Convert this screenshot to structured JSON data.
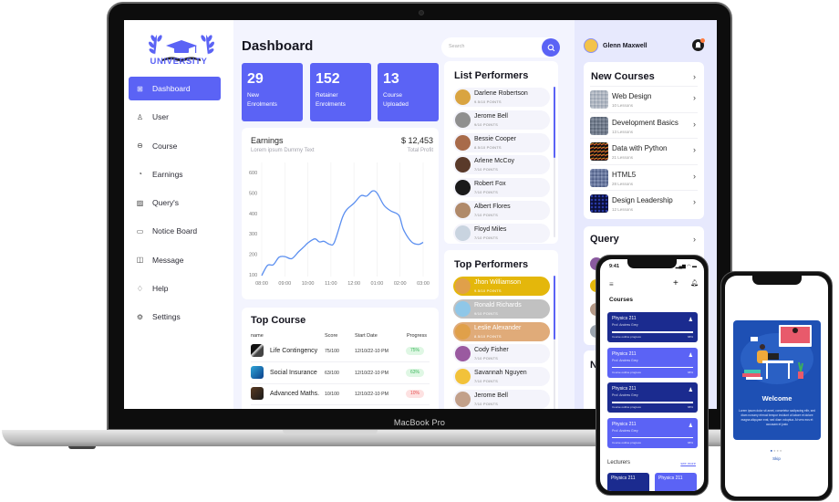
{
  "device_label": "MacBook Pro",
  "sidebar": {
    "logo_text": "UNIVERSITY",
    "items": [
      {
        "label": "Dashboard",
        "icon": "grid-icon",
        "active": true
      },
      {
        "label": "User",
        "icon": "user-icon"
      },
      {
        "label": "Course",
        "icon": "course-icon"
      },
      {
        "label": "Earnings",
        "icon": "wallet-icon"
      },
      {
        "label": "Query's",
        "icon": "edit-note-icon"
      },
      {
        "label": "Notice Board",
        "icon": "notice-icon"
      },
      {
        "label": "Message",
        "icon": "message-icon"
      },
      {
        "label": "Help",
        "icon": "help-icon"
      },
      {
        "label": "Settings",
        "icon": "settings-icon"
      }
    ]
  },
  "header": {
    "title": "Dashboard",
    "search_placeholder": "Search"
  },
  "stats": [
    {
      "value": "29",
      "label_line1": "New",
      "label_line2": "Enrolments"
    },
    {
      "value": "152",
      "label_line1": "Retainer",
      "label_line2": "Enrolments"
    },
    {
      "value": "13",
      "label_line1": "Course",
      "label_line2": "Uploaded"
    }
  ],
  "earnings": {
    "title": "Earnings",
    "subtitle": "Lorem ipsum Dummy Text",
    "amount": "$ 12,453",
    "amount_label": "Total Profit"
  },
  "chart_data": {
    "type": "line",
    "title": "Earnings",
    "xlabel": "",
    "ylabel": "",
    "categories": [
      "08:00",
      "09:00",
      "10:00",
      "11:00",
      "12:00",
      "01:00",
      "02:00",
      "03:00"
    ],
    "yticks": [
      100,
      200,
      300,
      400,
      500,
      600
    ],
    "ylim": [
      90,
      650
    ],
    "grid": true,
    "series": [
      {
        "name": "Earnings",
        "x": [
          0,
          0.25,
          0.5,
          0.75,
          1.0,
          1.3,
          1.6,
          1.85,
          2.0,
          2.3,
          2.5,
          2.7,
          2.95,
          3.15,
          3.5,
          3.7,
          4.0,
          4.3,
          4.55,
          4.8,
          5.0,
          5.3,
          5.6,
          5.95,
          6.15,
          6.5,
          6.8,
          7.0
        ],
        "values": [
          95,
          145,
          148,
          185,
          188,
          178,
          212,
          238,
          255,
          275,
          260,
          263,
          248,
          258,
          380,
          420,
          450,
          487,
          485,
          510,
          500,
          440,
          412,
          390,
          320,
          260,
          248,
          258
        ]
      }
    ]
  },
  "top_course": {
    "title": "Top Course",
    "columns": [
      "name",
      "Score",
      "Start Date",
      "Progress"
    ],
    "rows": [
      {
        "name": "Life Contingency",
        "score": "75/100",
        "date": "12/10/22-10 PM",
        "progress": "75%",
        "status": "good"
      },
      {
        "name": "Social Insurance",
        "score": "63/100",
        "date": "12/10/22-10 PM",
        "progress": "63%",
        "status": "good"
      },
      {
        "name": "Advanced Maths.",
        "score": "10/100",
        "date": "12/10/22-10 PM",
        "progress": "10%",
        "status": "bad"
      }
    ]
  },
  "list_performers": {
    "title": "List Performers",
    "items": [
      {
        "name": "Darlene Robertson",
        "points": "9.5/10 POINTS"
      },
      {
        "name": "Jerome Bell",
        "points": "9/10 POINTS"
      },
      {
        "name": "Bessie Cooper",
        "points": "8.5/10 POINTS"
      },
      {
        "name": "Arlene McCoy",
        "points": "7/10 POINTS"
      },
      {
        "name": "Robert Fox",
        "points": "7/10 POINTS"
      },
      {
        "name": "Albert Flores",
        "points": "7/10 POINTS"
      },
      {
        "name": "Floyd Miles",
        "points": "7/10 POINTS"
      }
    ]
  },
  "top_performers": {
    "title": "Top Performers",
    "items": [
      {
        "name": "Jhon Williamson",
        "points": "9.5/10 POINTS",
        "rank": "gold"
      },
      {
        "name": "Ronald Richards",
        "points": "9/10 POINTS",
        "rank": "silver"
      },
      {
        "name": "Leslie Alexander",
        "points": "8.5/10 POINTS",
        "rank": "bronze"
      },
      {
        "name": "Cody Fisher",
        "points": "7/10 POINTS",
        "rank": ""
      },
      {
        "name": "Savannah Nguyen",
        "points": "7/10 POINTS",
        "rank": ""
      },
      {
        "name": "Jerome Bell",
        "points": "7/10 POINTS",
        "rank": ""
      }
    ]
  },
  "user": {
    "name": "Glenn Maxwell"
  },
  "new_courses": {
    "title": "New Courses",
    "items": [
      {
        "name": "Web Design",
        "lessons": "10 Lessons"
      },
      {
        "name": "Development Basics",
        "lessons": "13 Lessons"
      },
      {
        "name": "Data with Python",
        "lessons": "21 Lessons"
      },
      {
        "name": "HTML5",
        "lessons": "28 Lessons"
      },
      {
        "name": "Design Leadership",
        "lessons": "12 Lessons"
      }
    ]
  },
  "query": {
    "title": "Query"
  },
  "notice": {
    "title": "N"
  },
  "phone1": {
    "time": "9:41",
    "status_icons": "▂▄▆ ◠ ▬",
    "heading": "Courses",
    "courses": [
      {
        "title": "Physics 211",
        "prof": "Prof. Andrew Grey",
        "progress_label": "Course outline progress",
        "progress": "68%",
        "style": "dark"
      },
      {
        "title": "Physics 211",
        "prof": "Prof. Andrew Grey",
        "progress_label": "Course outline progress",
        "progress": "68%",
        "style": "light"
      },
      {
        "title": "Physics 211",
        "prof": "Prof. Andrew Grey",
        "progress_label": "Course outline progress",
        "progress": "68%",
        "style": "dark"
      },
      {
        "title": "Physics 211",
        "prof": "Prof. Andrew Grey",
        "progress_label": "Course outline progress",
        "progress": "68%",
        "style": "light"
      }
    ],
    "lecturers_label": "Lecturers",
    "see_more": "see more",
    "lecturer_cards": [
      "Physics 211",
      "Physics 211"
    ]
  },
  "phone2": {
    "title": "Welcome",
    "text": "Lorem ipsum dolor sit amet, consetetur sadipscing elitr, sed diam nonumy eirmod tempor invidunt ut labore et dolore magna aliquyam erat, sed diam voluptua. At vero eos et accusam et justo",
    "skip": "Skip"
  },
  "colors": {
    "accent": "#5b63f5",
    "dark_accent": "#1b2b8f",
    "gold": "#e4b70b",
    "silver": "#c1c1c1",
    "bronze": "#e0ab79",
    "positive": "#3ab65b",
    "negative": "#e65050"
  }
}
